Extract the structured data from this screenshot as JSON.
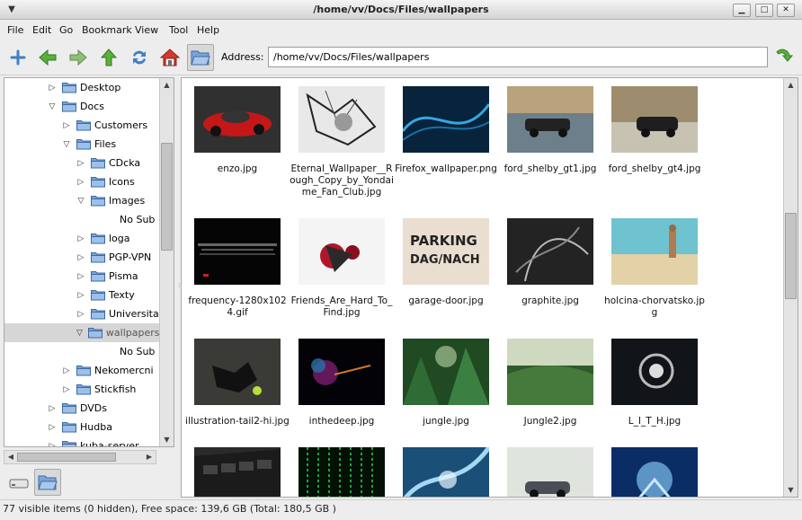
{
  "window": {
    "title": "/home/vv/Docs/Files/wallpapers",
    "minimize_glyph": "▁",
    "maximize_glyph": "□",
    "close_glyph": "✕"
  },
  "menu": [
    "File",
    "Edit",
    "Go",
    "Bookmark",
    "View",
    "Tool",
    "Help"
  ],
  "toolbar": {
    "buttons": [
      "new-tab-icon",
      "back-arrow-icon",
      "forward-arrow-icon",
      "up-arrow-icon",
      "reload-icon",
      "home-icon",
      "open-folder-icon"
    ],
    "address_label": "Address:",
    "address_value": "/home/vv/Docs/Files/wallpapers",
    "go_icon": "go-arrow-icon"
  },
  "tree": [
    {
      "label": "Desktop",
      "expander": "▷"
    },
    {
      "label": "Docs",
      "expander": "▽"
    },
    {
      "label": "Customers",
      "expander": "▷"
    },
    {
      "label": "Files",
      "expander": "▽"
    },
    {
      "label": "CDcka",
      "expander": "▷"
    },
    {
      "label": "Icons",
      "expander": "▷"
    },
    {
      "label": "Images",
      "expander": "▽"
    },
    {
      "label": "No Sub",
      "expander": ""
    },
    {
      "label": "loga",
      "expander": "▷"
    },
    {
      "label": "PGP-VPN",
      "expander": "▷"
    },
    {
      "label": "Pisma",
      "expander": "▷"
    },
    {
      "label": "Texty",
      "expander": "▷"
    },
    {
      "label": "Universita",
      "expander": "▷"
    },
    {
      "label": "wallpapers",
      "expander": "▽",
      "selected": true
    },
    {
      "label": "No Sub",
      "expander": ""
    },
    {
      "label": "Nekomercni",
      "expander": "▷"
    },
    {
      "label": "Stickfish",
      "expander": "▷"
    },
    {
      "label": "DVDs",
      "expander": "▷"
    },
    {
      "label": "Hudba",
      "expander": "▷"
    },
    {
      "label": "kuba-server",
      "expander": "▷"
    }
  ],
  "side_tabs": [
    "drive-icon",
    "folder-tree-icon"
  ],
  "files": [
    {
      "name": "enzo.jpg",
      "thumb": "red-car"
    },
    {
      "name": "Eternal_Wallpaper__Rough_Copy_by_Yondaime_Fan_Club.jpg",
      "thumb": "sketch"
    },
    {
      "name": "Firefox_wallpaper.png",
      "thumb": "blue-swirl"
    },
    {
      "name": "ford_shelby_gt1.jpg",
      "thumb": "street-car"
    },
    {
      "name": "ford_shelby_gt4.jpg",
      "thumb": "street-car2"
    },
    {
      "name": "frequency-1280x1024.gif",
      "thumb": "dark-noise"
    },
    {
      "name": "Friends_Are_Hard_To_Find.jpg",
      "thumb": "red-splash"
    },
    {
      "name": "garage-door.jpg",
      "thumb": "parking"
    },
    {
      "name": "graphite.jpg",
      "thumb": "graphite"
    },
    {
      "name": "holcina-chorvatsko.jpg",
      "thumb": "beach"
    },
    {
      "name": "illustration-tail2-hi.jpg",
      "thumb": "illustration"
    },
    {
      "name": "inthedeep.jpg",
      "thumb": "deep"
    },
    {
      "name": "jungle.jpg",
      "thumb": "jungle"
    },
    {
      "name": "Jungle2.jpg",
      "thumb": "jungle2"
    },
    {
      "name": "L_I_T_H.jpg",
      "thumb": "lith"
    },
    {
      "name": "",
      "thumb": "keyboard"
    },
    {
      "name": "",
      "thumb": "matrix"
    },
    {
      "name": "",
      "thumb": "blue-abstract"
    },
    {
      "name": "",
      "thumb": "mustang"
    },
    {
      "name": "",
      "thumb": "blue-robot"
    }
  ],
  "parking_text": [
    "PARKING",
    "DAG/NACH"
  ],
  "status": "77 visible items (0 hidden), Free space: 139,6 GB (Total: 180,5 GB )"
}
